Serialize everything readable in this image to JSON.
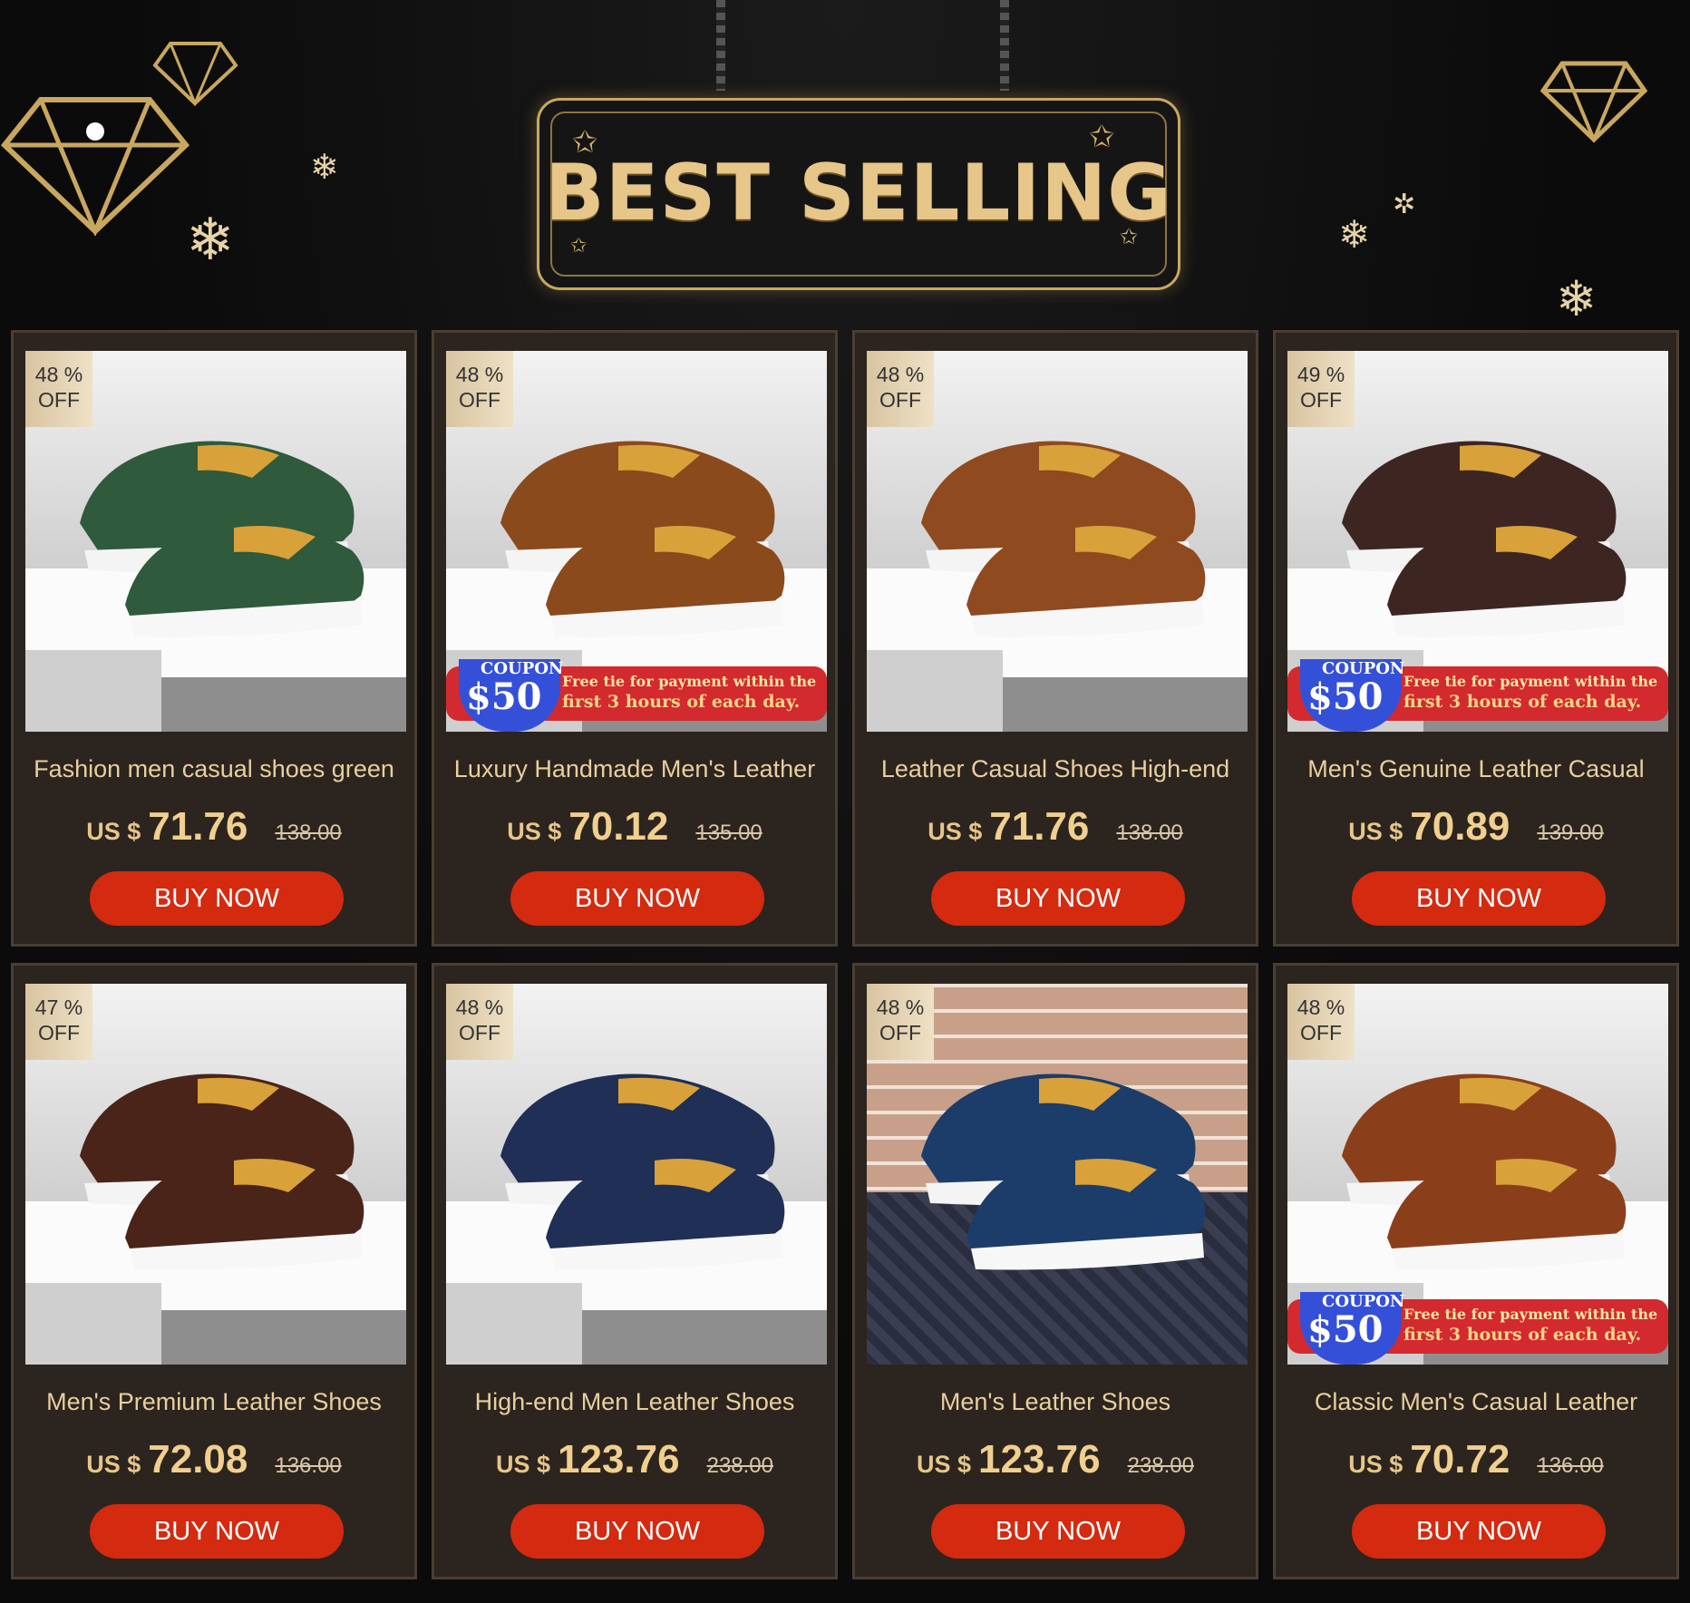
{
  "header": {
    "title": "BEST SELLING"
  },
  "products": [
    {
      "badge_pct": "48 %",
      "badge_off": "OFF",
      "title": "Fashion men casual shoes green",
      "currency": "US $",
      "price": "71.76",
      "original": "138.00",
      "button": "BUY NOW",
      "coupon": false,
      "shoe_color": "#2f5a3b",
      "scene": "studio"
    },
    {
      "badge_pct": "48 %",
      "badge_off": "OFF",
      "title": "Luxury Handmade Men's Leather",
      "currency": "US $",
      "price": "70.12",
      "original": "135.00",
      "button": "BUY NOW",
      "coupon": true,
      "shoe_color": "#8a4a1c",
      "scene": "studio"
    },
    {
      "badge_pct": "48 %",
      "badge_off": "OFF",
      "title": "Leather Casual Shoes High-end",
      "currency": "US $",
      "price": "71.76",
      "original": "138.00",
      "button": "BUY NOW",
      "coupon": false,
      "shoe_color": "#8f4a1f",
      "scene": "studio"
    },
    {
      "badge_pct": "49 %",
      "badge_off": "OFF",
      "title": "Men's Genuine Leather Casual",
      "currency": "US $",
      "price": "70.89",
      "original": "139.00",
      "button": "BUY NOW",
      "coupon": true,
      "shoe_color": "#3d2622",
      "scene": "studio"
    },
    {
      "badge_pct": "47 %",
      "badge_off": "OFF",
      "title": "Men's Premium Leather Shoes",
      "currency": "US $",
      "price": "72.08",
      "original": "136.00",
      "button": "BUY NOW",
      "coupon": false,
      "shoe_color": "#4a2418",
      "scene": "studio"
    },
    {
      "badge_pct": "48 %",
      "badge_off": "OFF",
      "title": "High-end Men Leather Shoes",
      "currency": "US $",
      "price": "123.76",
      "original": "238.00",
      "button": "BUY NOW",
      "coupon": false,
      "shoe_color": "#1f2f55",
      "scene": "studio"
    },
    {
      "badge_pct": "48 %",
      "badge_off": "OFF",
      "title": "Men's Leather Shoes",
      "currency": "US $",
      "price": "123.76",
      "original": "238.00",
      "button": "BUY NOW",
      "coupon": false,
      "shoe_color": "#1c3c6a",
      "scene": "brick"
    },
    {
      "badge_pct": "48 %",
      "badge_off": "OFF",
      "title": "Classic Men's Casual Leather",
      "currency": "US $",
      "price": "70.72",
      "original": "136.00",
      "button": "BUY NOW",
      "coupon": true,
      "shoe_color": "#8a3f1a",
      "scene": "studio"
    }
  ],
  "coupon": {
    "label": "COUPON",
    "amount": "$50",
    "line1": "Free tie for payment within the",
    "line2": "first 3 hours of each day."
  }
}
